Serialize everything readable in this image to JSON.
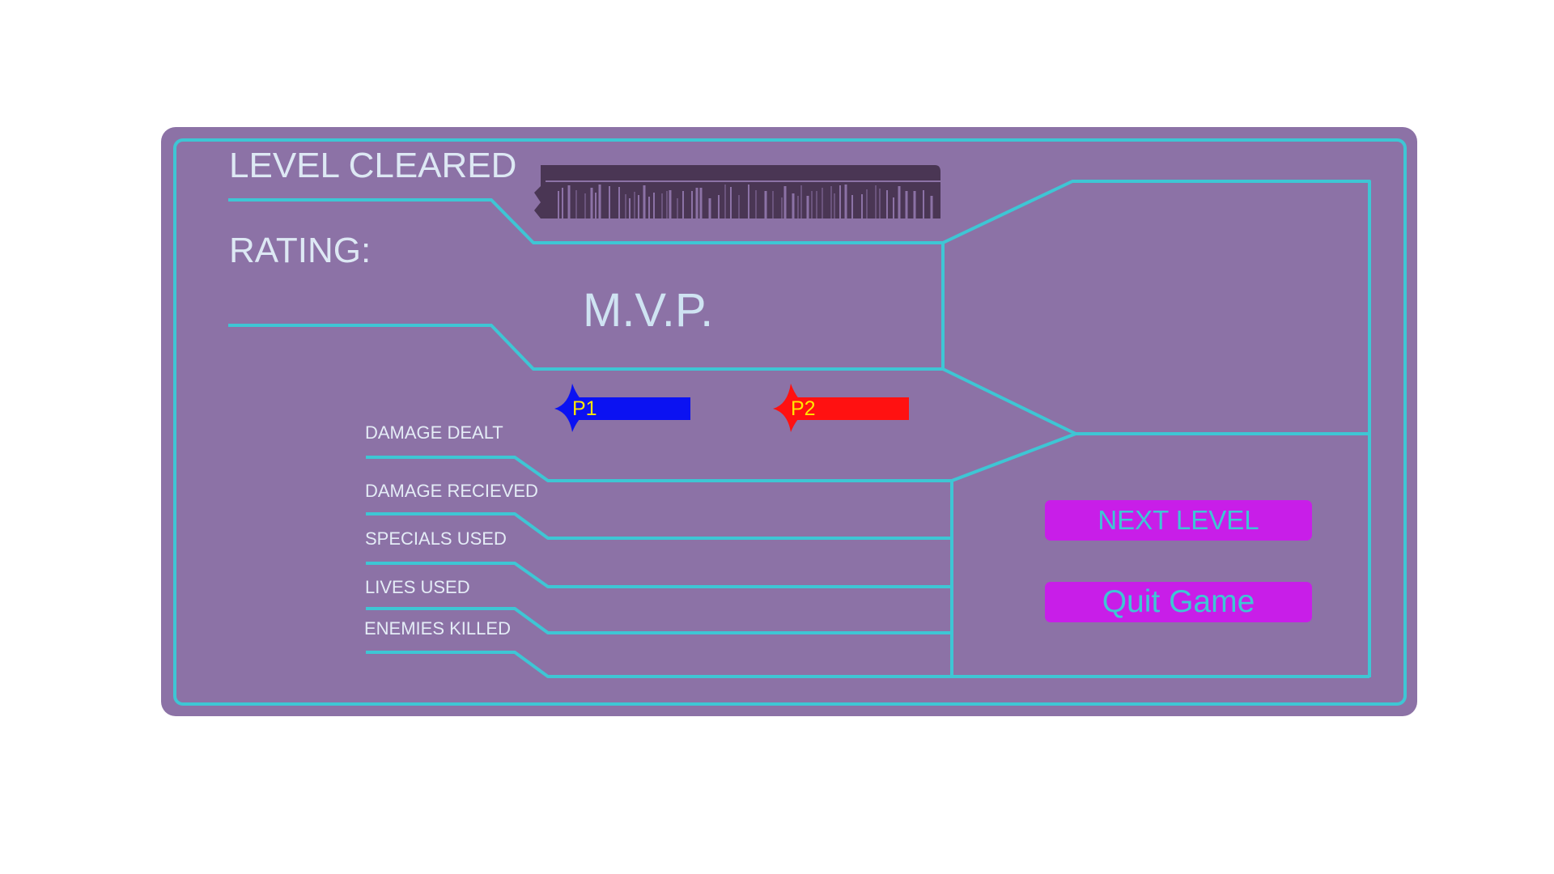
{
  "header": {
    "title": "LEVEL CLEARED",
    "rating_label": "RATING:"
  },
  "rating": {
    "value": "M.V.P."
  },
  "players": [
    {
      "label": "P1",
      "color": "#0b12f2"
    },
    {
      "label": "P2",
      "color": "#ff1111"
    }
  ],
  "stats": {
    "labels": [
      "DAMAGE DEALT",
      "DAMAGE RECIEVED",
      "SPECIALS USED",
      "LIVES USED",
      "ENEMIES KILLED"
    ]
  },
  "buttons": {
    "next_level": "NEXT LEVEL",
    "quit_game": "Quit Game"
  },
  "colors": {
    "panel_bg": "#8c72a6",
    "line_accent": "#3ec6d4",
    "button_bg": "#c81ee8",
    "button_text": "#3ec6d4",
    "barcode": "#4a3654"
  }
}
